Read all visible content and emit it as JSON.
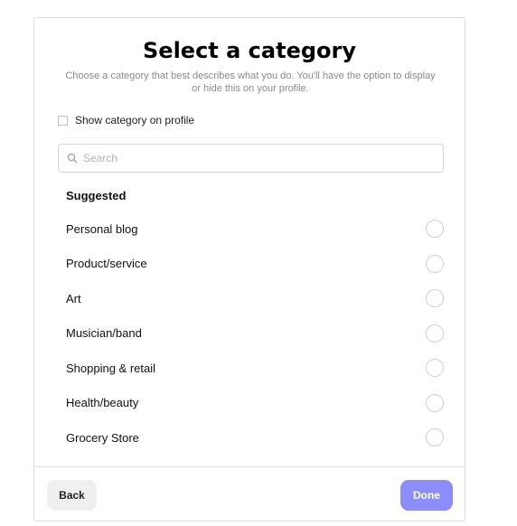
{
  "dialog": {
    "title": "Select a category",
    "subtitle": "Choose a category that best describes what you do. You'll have the option to display or hide this on your profile."
  },
  "show_category": {
    "label": "Show category on profile",
    "checked": false
  },
  "search": {
    "placeholder": "Search",
    "value": "",
    "icon": "search-icon"
  },
  "suggested": {
    "heading": "Suggested",
    "options": [
      {
        "label": "Personal blog",
        "selected": false
      },
      {
        "label": "Product/service",
        "selected": false
      },
      {
        "label": "Art",
        "selected": false
      },
      {
        "label": "Musician/band",
        "selected": false
      },
      {
        "label": "Shopping & retail",
        "selected": false
      },
      {
        "label": "Health/beauty",
        "selected": false
      },
      {
        "label": "Grocery Store",
        "selected": false
      }
    ]
  },
  "footer": {
    "back_label": "Back",
    "done_label": "Done"
  },
  "colors": {
    "done_button": "#8c8dfa",
    "back_button": "#efefef",
    "border": "#dcdcdc",
    "subtitle_text": "#8a8a8a"
  }
}
